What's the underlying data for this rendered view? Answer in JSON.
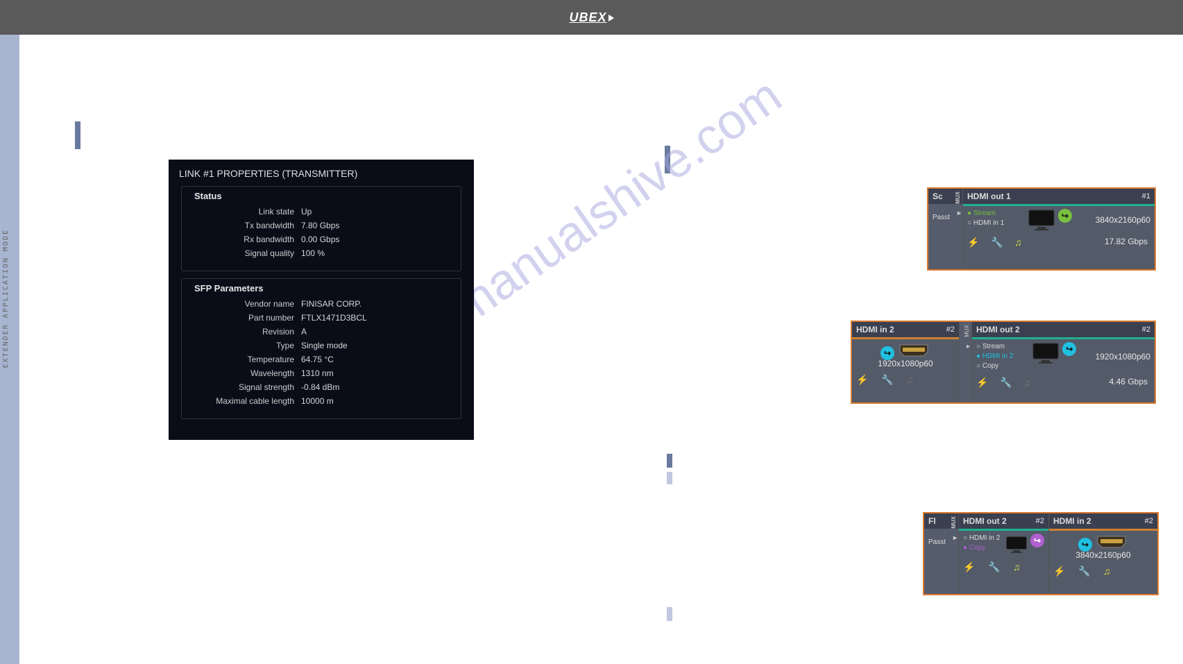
{
  "header": {
    "logo": "UBEX"
  },
  "sidebar": {
    "text": "EXTENDER  APPLICATION  MODE"
  },
  "properties_panel": {
    "title": "LINK #1 PROPERTIES (TRANSMITTER)",
    "status": {
      "section_title": "Status",
      "link_state": {
        "label": "Link state",
        "value": "Up"
      },
      "tx_bw": {
        "label": "Tx bandwidth",
        "value": "7.80 Gbps"
      },
      "rx_bw": {
        "label": "Rx bandwidth",
        "value": "0.00 Gbps"
      },
      "signal_quality": {
        "label": "Signal quality",
        "value": "100 %"
      }
    },
    "sfp": {
      "section_title": "SFP Parameters",
      "vendor": {
        "label": "Vendor name",
        "value": "FINISAR CORP."
      },
      "part": {
        "label": "Part number",
        "value": "FTLX1471D3BCL"
      },
      "revision": {
        "label": "Revision",
        "value": "A"
      },
      "type": {
        "label": "Type",
        "value": "Single mode"
      },
      "temperature": {
        "label": "Temperature",
        "value": "64.75 °C"
      },
      "wavelength": {
        "label": "Wavelength",
        "value": "1310 nm"
      },
      "signal_strength": {
        "label": "Signal strength",
        "value": "-0.84 dBm"
      },
      "max_cable": {
        "label": "Maximal cable length",
        "value": "10000 m"
      }
    }
  },
  "tiles": {
    "tile1": {
      "side_label": "Sc",
      "side_sub": "Passt",
      "mux_label": "MUX",
      "out_title": "HDMI out 1",
      "out_num": "#1",
      "sources": {
        "stream": "Stream",
        "hdmi": "HDMI in 1"
      },
      "resolution": "3840x2160p60",
      "bandwidth": "17.82 Gbps"
    },
    "tile2": {
      "in_title": "HDMI in 2",
      "in_num": "#2",
      "in_resolution": "1920x1080p60",
      "mux_label": "MUX",
      "out_title": "HDMI out 2",
      "out_num": "#2",
      "sources": {
        "stream": "Stream",
        "hdmi": "HDMI in 2",
        "copy": "Copy"
      },
      "out_resolution": "1920x1080p60",
      "bandwidth": "4.46 Gbps"
    },
    "tile3": {
      "side_label": "Fl",
      "side_sub": "Passt",
      "mux_label": "MUX",
      "out_title": "HDMI out 2",
      "out_num": "#2",
      "sources": {
        "hdmi": "HDMI in 2",
        "copy": "Copy"
      },
      "in_title": "HDMI in 2",
      "in_num": "#2",
      "in_resolution": "3840x2160p60"
    }
  },
  "watermark": "manualshive.com"
}
